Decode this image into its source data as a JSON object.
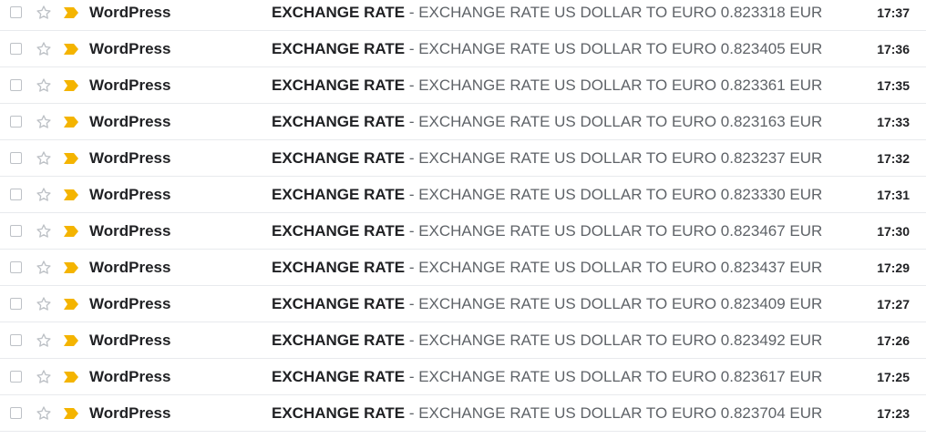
{
  "colors": {
    "important_marker": "#f4b400",
    "star_outline": "#bdc1c6",
    "checkbox_border": "#bdc1c6",
    "row_divider": "#e8eaed",
    "text_primary": "#202124",
    "text_secondary": "#5f6368"
  },
  "icons": {
    "checkbox": "checkbox-icon",
    "star": "star-outline-icon",
    "important": "important-marker-icon"
  },
  "emails": [
    {
      "sender": "WordPress",
      "subject": "EXCHANGE RATE",
      "separator": " - ",
      "snippet": "EXCHANGE RATE US DOLLAR TO EURO 0.823318 EUR",
      "time": "17:37"
    },
    {
      "sender": "WordPress",
      "subject": "EXCHANGE RATE",
      "separator": " - ",
      "snippet": "EXCHANGE RATE US DOLLAR TO EURO 0.823405 EUR",
      "time": "17:36"
    },
    {
      "sender": "WordPress",
      "subject": "EXCHANGE RATE",
      "separator": " - ",
      "snippet": "EXCHANGE RATE US DOLLAR TO EURO 0.823361 EUR",
      "time": "17:35"
    },
    {
      "sender": "WordPress",
      "subject": "EXCHANGE RATE",
      "separator": " - ",
      "snippet": "EXCHANGE RATE US DOLLAR TO EURO 0.823163 EUR",
      "time": "17:33"
    },
    {
      "sender": "WordPress",
      "subject": "EXCHANGE RATE",
      "separator": " - ",
      "snippet": "EXCHANGE RATE US DOLLAR TO EURO 0.823237 EUR",
      "time": "17:32"
    },
    {
      "sender": "WordPress",
      "subject": "EXCHANGE RATE",
      "separator": " - ",
      "snippet": "EXCHANGE RATE US DOLLAR TO EURO 0.823330 EUR",
      "time": "17:31"
    },
    {
      "sender": "WordPress",
      "subject": "EXCHANGE RATE",
      "separator": " - ",
      "snippet": "EXCHANGE RATE US DOLLAR TO EURO 0.823467 EUR",
      "time": "17:30"
    },
    {
      "sender": "WordPress",
      "subject": "EXCHANGE RATE",
      "separator": " - ",
      "snippet": "EXCHANGE RATE US DOLLAR TO EURO 0.823437 EUR",
      "time": "17:29"
    },
    {
      "sender": "WordPress",
      "subject": "EXCHANGE RATE",
      "separator": " - ",
      "snippet": "EXCHANGE RATE US DOLLAR TO EURO 0.823409 EUR",
      "time": "17:27"
    },
    {
      "sender": "WordPress",
      "subject": "EXCHANGE RATE",
      "separator": " - ",
      "snippet": "EXCHANGE RATE US DOLLAR TO EURO 0.823492 EUR",
      "time": "17:26"
    },
    {
      "sender": "WordPress",
      "subject": "EXCHANGE RATE",
      "separator": " - ",
      "snippet": "EXCHANGE RATE US DOLLAR TO EURO 0.823617 EUR",
      "time": "17:25"
    },
    {
      "sender": "WordPress",
      "subject": "EXCHANGE RATE",
      "separator": " - ",
      "snippet": "EXCHANGE RATE US DOLLAR TO EURO 0.823704 EUR",
      "time": "17:23"
    }
  ]
}
